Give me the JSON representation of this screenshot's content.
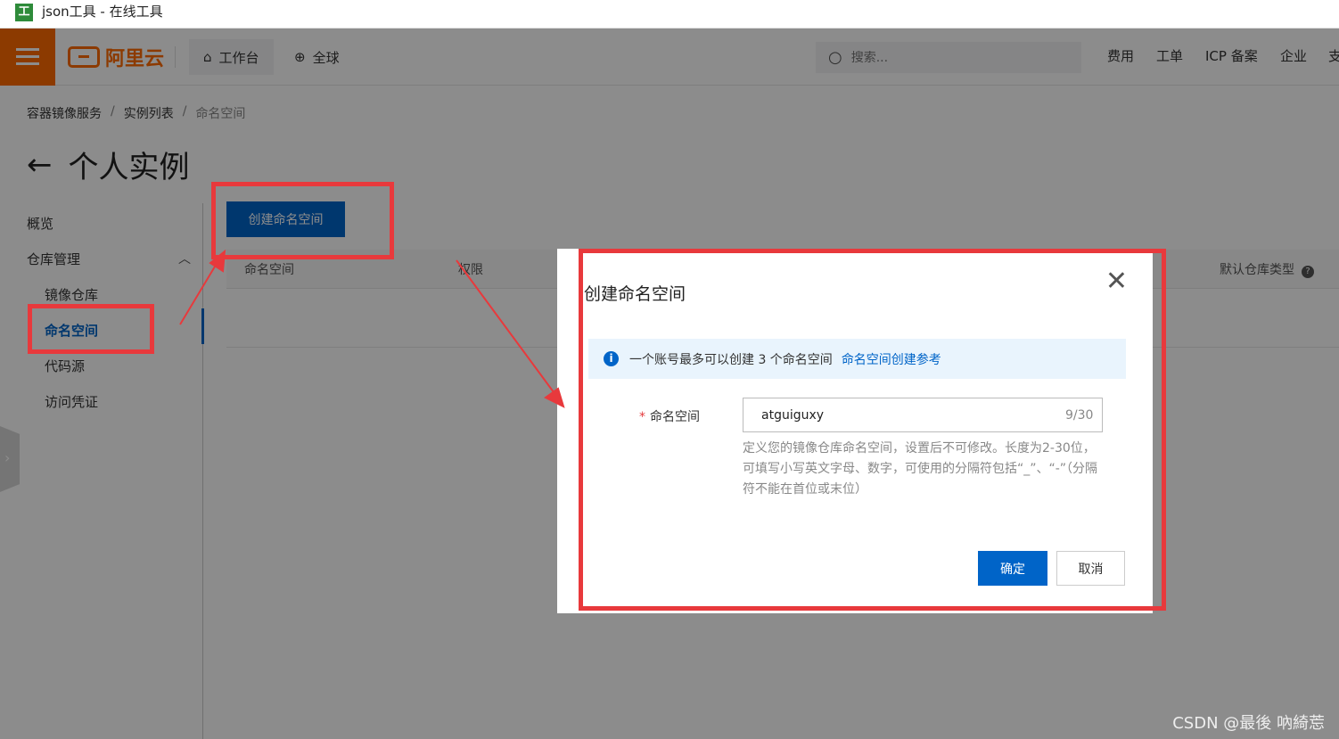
{
  "browser": {
    "tab_icon": "工",
    "tab_title": "json工具 - 在线工具"
  },
  "topnav": {
    "logo_text": "阿里云",
    "workbench": "工作台",
    "global": "全球",
    "search_placeholder": "搜索...",
    "links": [
      "费用",
      "工单",
      "ICP 备案",
      "企业",
      "支"
    ]
  },
  "breadcrumb": {
    "items": [
      "容器镜像服务",
      "实例列表",
      "命名空间"
    ],
    "separator": "/"
  },
  "page": {
    "title": "个人实例",
    "back_glyph": "←"
  },
  "sidebar": {
    "overview": "概览",
    "repo_manage": "仓库管理",
    "image_repo": "镜像仓库",
    "namespace": "命名空间",
    "code_source": "代码源",
    "access_credential": "访问凭证"
  },
  "toolbar": {
    "create_button": "创建命名空间"
  },
  "table": {
    "col_namespace": "命名空间",
    "col_permission": "权限",
    "col_default_type": "默认仓库类型"
  },
  "modal": {
    "title": "创建命名空间",
    "notice_text": "一个账号最多可以创建 3 个命名空间",
    "notice_link": "命名空间创建参考",
    "field_label": "命名空间",
    "required_mark": "*",
    "field_value": "atguiguxy",
    "counter": "9/30",
    "help_text": "定义您的镜像仓库命名空间，设置后不可修改。长度为2-30位，可填写小写英文字母、数字，可使用的分隔符包括“_”、“-”（分隔符不能在首位或末位）",
    "confirm": "确定",
    "cancel": "取消"
  },
  "watermark": "CSDN @最後 吶綺莣",
  "colors": {
    "brand_orange": "#ff6a00",
    "primary_blue": "#0064c8",
    "annotation_red": "#e8393c"
  }
}
